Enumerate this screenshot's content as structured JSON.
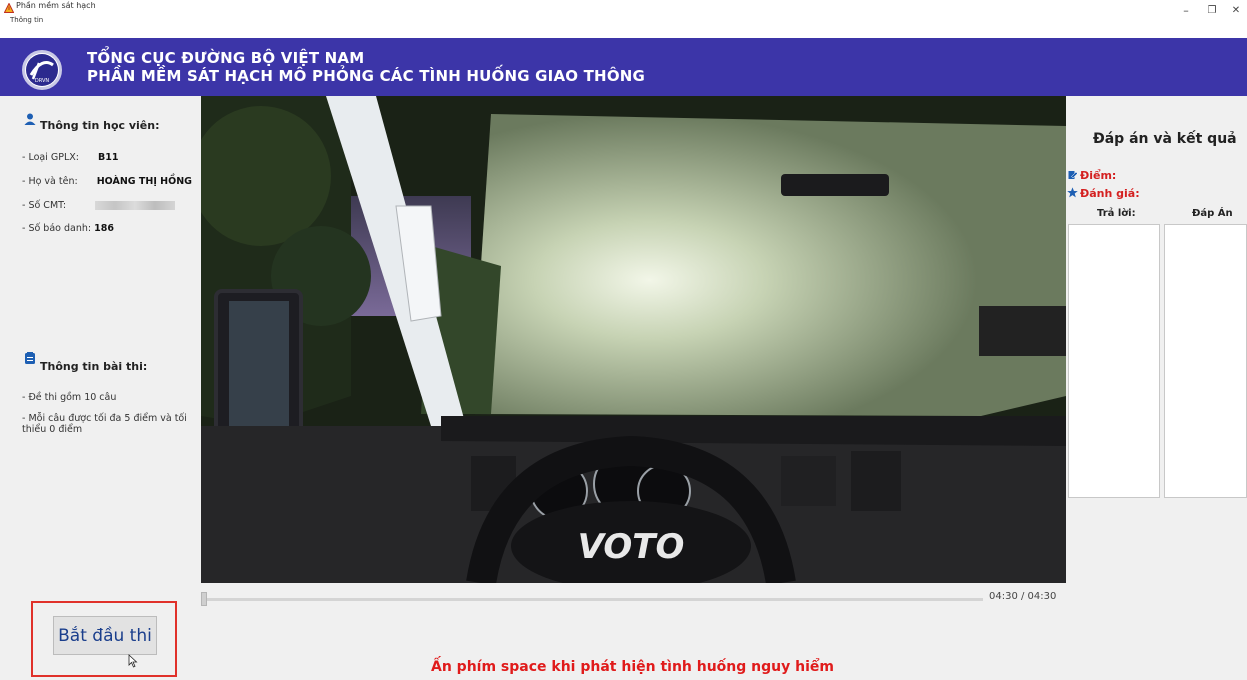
{
  "window": {
    "title": "Phần mềm sát hạch",
    "menu": "Thông tin",
    "controls": {
      "minimize": "–",
      "restore": "❐",
      "close": "✕"
    }
  },
  "header": {
    "line1": "TỔNG CỤC ĐƯỜNG BỘ VIỆT NAM",
    "line2": "PHẦN MỀM SÁT HẠCH MÔ PHỎNG CÁC TÌNH HUỐNG GIAO THÔNG",
    "logo_text": "DRVN",
    "color": "#3c35a8"
  },
  "student": {
    "heading": "Thông tin học viên:",
    "rows": [
      {
        "label": "- Loại GPLX:",
        "value": "B11"
      },
      {
        "label": "- Họ và tên:",
        "value": "HOÀNG THỊ HỒNG"
      },
      {
        "label": "- Số CMT:",
        "value": ""
      },
      {
        "label": "- Số báo danh:",
        "value": "186"
      }
    ]
  },
  "exam": {
    "heading": "Thông tin bài thi:",
    "line1": "- Đề thi gồm 10 câu",
    "line2a": "- Mỗi câu được tối đa 5 điểm và tối",
    "line2b": "thiểu 0 điểm"
  },
  "start_button": "Bắt đầu thi",
  "video": {
    "brand": "VOTO",
    "time": "04:30 / 04:30",
    "progress": 0.0
  },
  "hint": "Ấn phím space khi phát hiện tình huống nguy hiểm",
  "results": {
    "title": "Đáp án và kết quả",
    "score_label": "Điểm:",
    "rating_label": "Đánh giá:",
    "col_answer": "Trả lời:",
    "col_key": "Đáp Án"
  },
  "colors": {
    "accent_red": "#d42020",
    "highlight_border": "#e0312a",
    "button_text": "#1a3e8c"
  }
}
